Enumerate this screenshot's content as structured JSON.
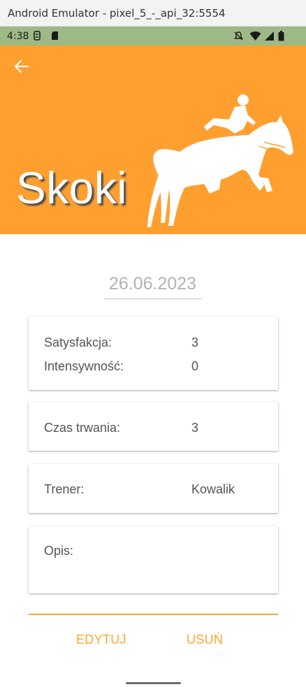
{
  "window": {
    "title": "Android Emulator - pixel_5_-_api_32:5554"
  },
  "status_bar": {
    "time": "4:38"
  },
  "header": {
    "title": "Skoki",
    "back_icon": "arrow-left-icon",
    "illustration": "horse-jumping-icon",
    "color": "#ff9f2f"
  },
  "entry": {
    "date": "26.06.2023",
    "cards": {
      "satisfaction": {
        "label": "Satysfakcja:",
        "value": "3"
      },
      "intensity": {
        "label": "Intensywność:",
        "value": "0"
      },
      "duration": {
        "label": "Czas trwania:",
        "value": "3"
      },
      "trainer": {
        "label": "Trener:",
        "value": "Kowalik"
      },
      "description": {
        "label": "Opis:",
        "value": ""
      }
    }
  },
  "actions": {
    "edit": "EDYTUJ",
    "delete": "USUŃ",
    "accent": "#ffa42b"
  }
}
